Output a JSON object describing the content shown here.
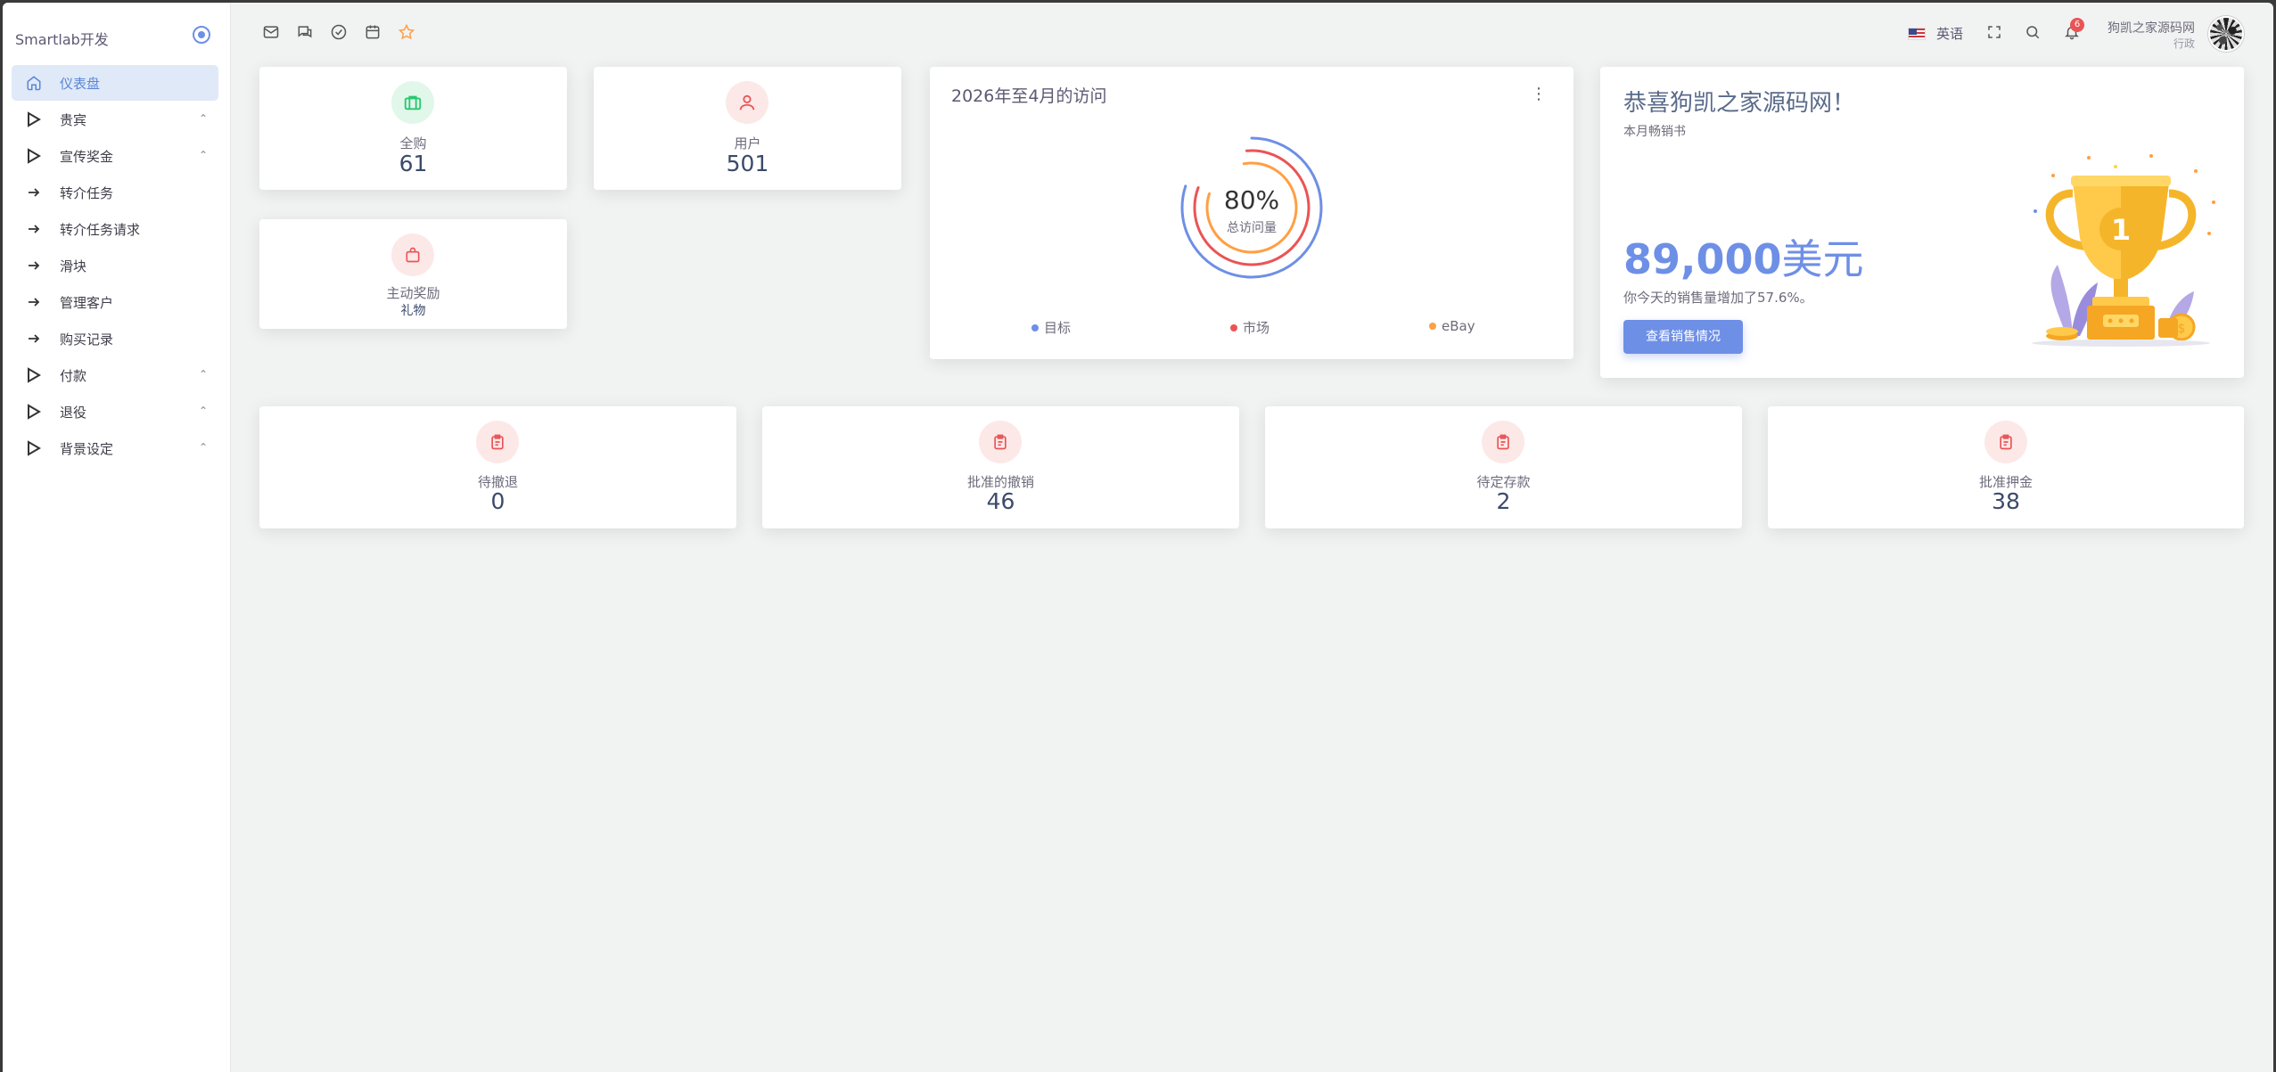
{
  "sidebar": {
    "brand": "Smartlab开发",
    "items": [
      {
        "label": "仪表盘",
        "icon": "home-icon",
        "active": true,
        "chevron": false
      },
      {
        "label": "贵宾",
        "icon": "play-icon",
        "chevron": true
      },
      {
        "label": "宣传奖金",
        "icon": "play-icon",
        "chevron": true
      },
      {
        "label": "转介任务",
        "icon": "arrow-right-icon",
        "chevron": false
      },
      {
        "label": "转介任务请求",
        "icon": "arrow-right-icon",
        "chevron": false
      },
      {
        "label": "滑块",
        "icon": "arrow-right-icon",
        "chevron": false
      },
      {
        "label": "管理客户",
        "icon": "arrow-right-icon",
        "chevron": false
      },
      {
        "label": "购买记录",
        "icon": "arrow-right-icon",
        "chevron": false
      },
      {
        "label": "付款",
        "icon": "play-icon",
        "chevron": true
      },
      {
        "label": "退役",
        "icon": "play-icon",
        "chevron": true
      },
      {
        "label": "背景设定",
        "icon": "play-icon",
        "chevron": true
      }
    ]
  },
  "topbar": {
    "language": "英语",
    "notification_count": "6",
    "user_name": "狗凯之家源码网",
    "user_role": "行政"
  },
  "stats_top": [
    {
      "label": "全购",
      "value": "61",
      "icon": "briefcase-icon",
      "color": "#28c76f",
      "bg": "#e0f7ea"
    },
    {
      "label": "用户",
      "value": "501",
      "icon": "user-icon",
      "color": "#ea5455",
      "bg": "#fde8e8"
    },
    {
      "label": "主动奖励",
      "value": "礼物",
      "icon": "shopping-bag-icon",
      "color": "#ea5455",
      "bg": "#fde8e8"
    }
  ],
  "visits": {
    "title": "2026年至4月的访问",
    "center_value": "80%",
    "center_label": "总访问量",
    "legend": [
      {
        "label": "目标",
        "color": "#6e8fe6"
      },
      {
        "label": "市场",
        "color": "#ea5455"
      },
      {
        "label": "eBay",
        "color": "#ff9f43"
      }
    ]
  },
  "promo": {
    "title": "恭喜狗凯之家源码网！",
    "subtitle": "本月畅销书",
    "amount": "89,000",
    "amount_unit": "美元",
    "note": "你今天的销售量增加了57.6%。",
    "button": "查看销售情况"
  },
  "stats_bottom": [
    {
      "label": "待撤退",
      "value": "0"
    },
    {
      "label": "批准的撤销",
      "value": "46"
    },
    {
      "label": "待定存款",
      "value": "2"
    },
    {
      "label": "批准押金",
      "value": "38"
    }
  ],
  "colors": {
    "accent": "#6e8fe6",
    "danger": "#ea5455",
    "success": "#28c76f",
    "warning": "#ff9f43"
  }
}
